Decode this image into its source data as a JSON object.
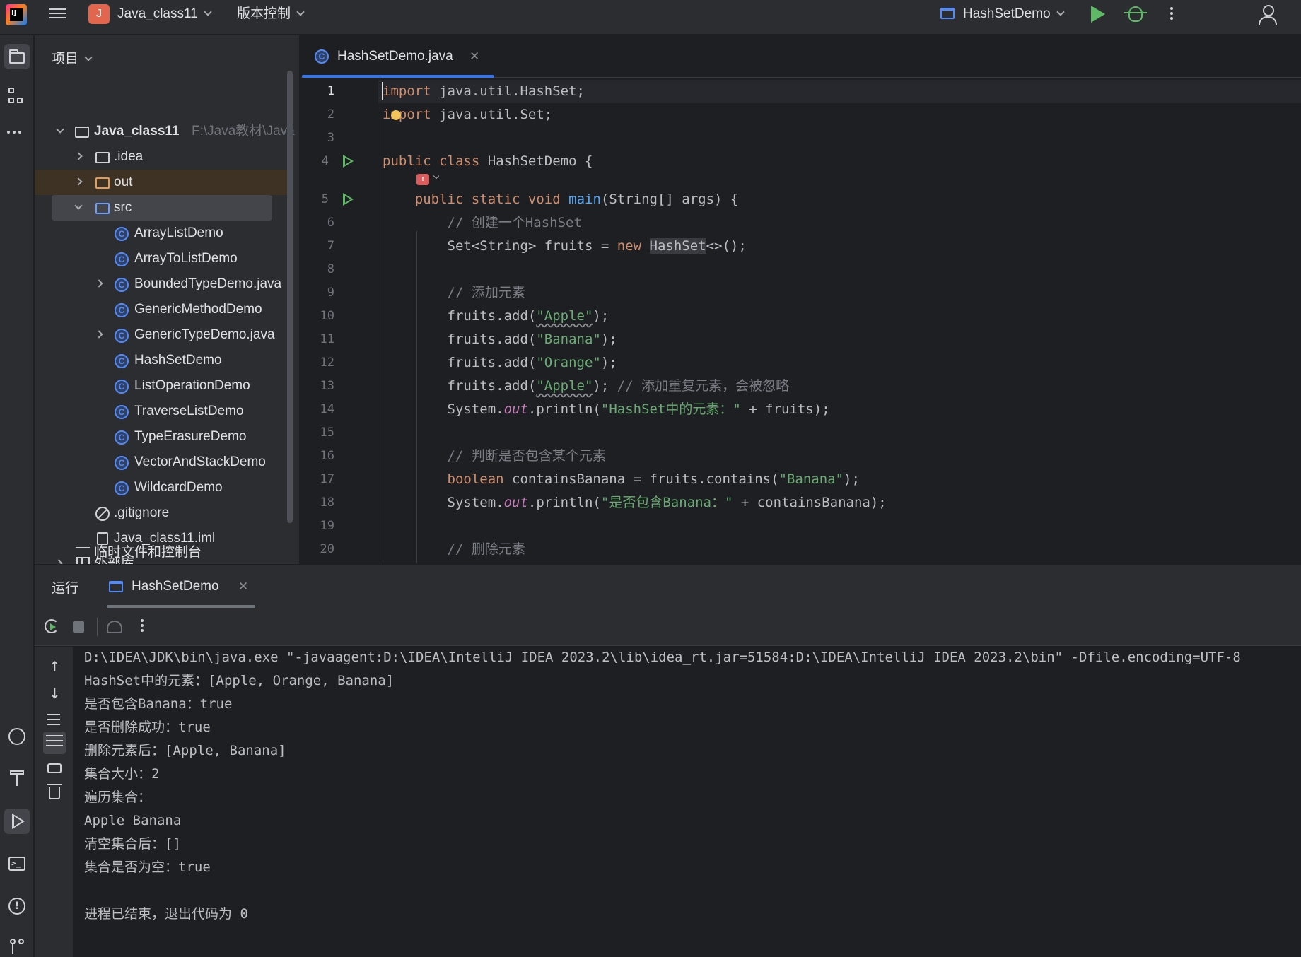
{
  "titlebar": {
    "project_initial": "J",
    "project_name": "Java_class11",
    "vcs_label": "版本控制",
    "run_config": "HashSetDemo"
  },
  "project_panel": {
    "header": "项目",
    "root_name": "Java_class11",
    "root_path": "F:\\Java教材\\Java",
    "items": [
      {
        "label": ".idea"
      },
      {
        "label": "out"
      },
      {
        "label": "src"
      },
      {
        "label": "ArrayListDemo"
      },
      {
        "label": "ArrayToListDemo"
      },
      {
        "label": "BoundedTypeDemo.java"
      },
      {
        "label": "GenericMethodDemo"
      },
      {
        "label": "GenericTypeDemo.java"
      },
      {
        "label": "HashSetDemo"
      },
      {
        "label": "ListOperationDemo"
      },
      {
        "label": "TraverseListDemo"
      },
      {
        "label": "TypeErasureDemo"
      },
      {
        "label": "VectorAndStackDemo"
      },
      {
        "label": "WildcardDemo"
      },
      {
        "label": ".gitignore"
      },
      {
        "label": "Java_class11.iml"
      },
      {
        "label": "外部库"
      },
      {
        "label": "临时文件和控制台"
      }
    ]
  },
  "editor": {
    "tab_label": "HashSetDemo.java",
    "class_icon_letter": "C",
    "line_numbers": [
      "1",
      "2",
      "3",
      "4",
      "5",
      "6",
      "7",
      "8",
      "9",
      "10",
      "11",
      "12",
      "13",
      "14",
      "15",
      "16",
      "17",
      "18",
      "19",
      "20"
    ],
    "code": {
      "l1_kw": "import",
      "l1_rest": " java.util.HashSet;",
      "l2_kw": "import",
      "l2_rest": " java.util.Set;",
      "l4_kw": "public class",
      "l4_rest": " HashSetDemo {",
      "l5_kw": "    public static void",
      "l5_fn": "main",
      "l5_rest": "(String[] args) {",
      "l6_cmt": "        // 创建一个HashSet",
      "l7_a": "        Set<String> fruits = ",
      "l7_kw": "new",
      "l7_sp": " ",
      "l7_hl": "HashSet",
      "l7_b": "<>();",
      "l9_cmt": "        // 添加元素",
      "l10_a": "        fruits.add(",
      "l10_str": "\"Apple\"",
      "l10_b": ");",
      "l11_a": "        fruits.add(",
      "l11_str": "\"Banana\"",
      "l11_b": ");",
      "l12_a": "        fruits.add(",
      "l12_str": "\"Orange\"",
      "l12_b": ");",
      "l13_a": "        fruits.add(",
      "l13_str": "\"Apple\"",
      "l13_b": "); ",
      "l13_cmt": "// 添加重复元素，会被忽略",
      "l14_a": "        System.",
      "l14_st": "out",
      "l14_b": ".println(",
      "l14_str": "\"HashSet中的元素：\"",
      "l14_c": " + fruits);",
      "l16_cmt": "        // 判断是否包含某个元素",
      "l17_kw": "        boolean",
      "l17_a": " containsBanana = fruits.contains(",
      "l17_str": "\"Banana\"",
      "l17_b": ");",
      "l18_a": "        System.",
      "l18_st": "out",
      "l18_b": ".println(",
      "l18_str": "\"是否包含Banana：\"",
      "l18_c": " + containsBanana);",
      "l20_cmt": "        // 删除元素"
    }
  },
  "run_panel": {
    "label": "运行",
    "tab_label": "HashSetDemo",
    "output": [
      "D:\\IDEA\\JDK\\bin\\java.exe \"-javaagent:D:\\IDEA\\IntelliJ IDEA 2023.2\\lib\\idea_rt.jar=51584:D:\\IDEA\\IntelliJ IDEA 2023.2\\bin\" -Dfile.encoding=UTF-8",
      "HashSet中的元素：[Apple, Orange, Banana]",
      "是否包含Banana：true",
      "是否删除成功：true",
      "删除元素后：[Apple, Banana]",
      "集合大小：2",
      "遍历集合：",
      "Apple Banana",
      "清空集合后：[]",
      "集合是否为空：true",
      "",
      "进程已结束，退出代码为 0"
    ]
  },
  "colors": {
    "background": "#1e1f22",
    "panel": "#2b2d30",
    "keyword": "#cf8e6d",
    "string": "#6aab73",
    "function": "#56a8f5",
    "comment": "#7a7e85",
    "run_green": "#5fb865",
    "accent": "#3574f0"
  }
}
